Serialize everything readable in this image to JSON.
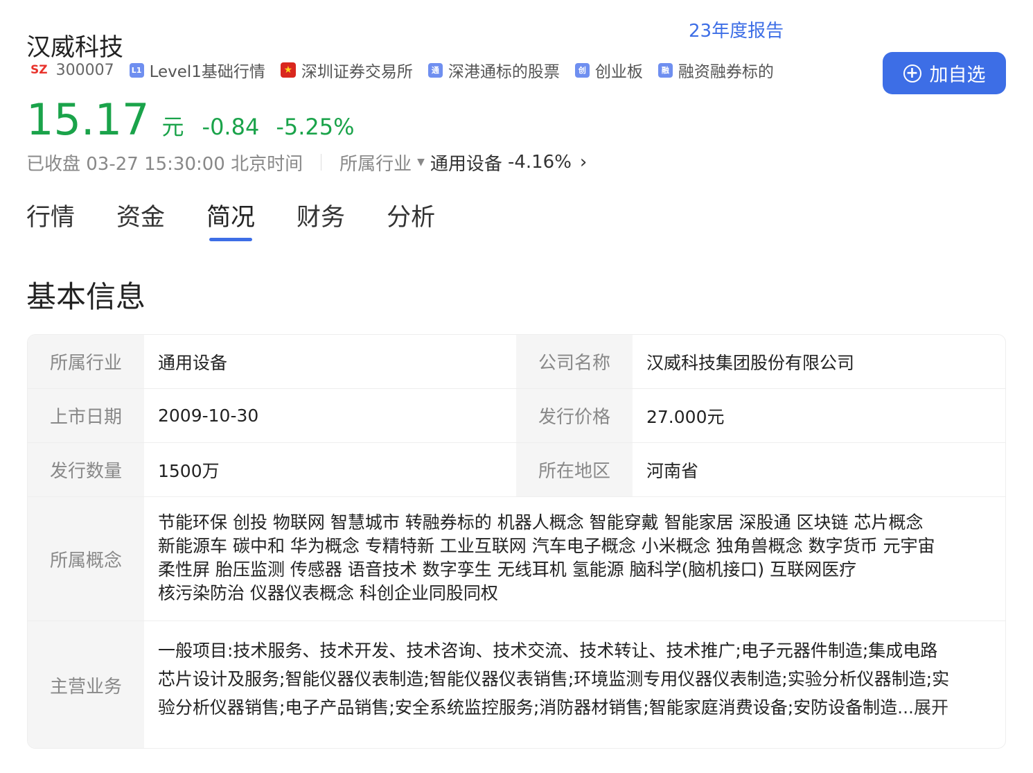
{
  "header": {
    "report_link": "23年度报告",
    "stock_name": "汉威科技",
    "market": "SZ",
    "code": "300007",
    "tags": [
      {
        "icon": "L1",
        "label": "Level1基础行情"
      },
      {
        "icon": "★",
        "label": "深圳证券交易所"
      },
      {
        "icon": "通",
        "label": "深港通标的股票"
      },
      {
        "icon": "创",
        "label": "创业板"
      },
      {
        "icon": "融",
        "label": "融资融券标的"
      }
    ],
    "add_button": "加自选"
  },
  "quote": {
    "price": "15.17",
    "unit": "元",
    "change": "-0.84",
    "change_pct": "-5.25%",
    "status": "已收盘 03-27 15:30:00 北京时间",
    "industry_label": "所属行业",
    "industry_name": "通用设备",
    "industry_pct": "-4.16%"
  },
  "tabs": [
    "行情",
    "资金",
    "简况",
    "财务",
    "分析"
  ],
  "section_title": "基本信息",
  "info": {
    "industry_label": "所属行业",
    "industry_value": "通用设备",
    "company_label": "公司名称",
    "company_value": "汉威科技集团股份有限公司",
    "listing_label": "上市日期",
    "listing_value": "2009-10-30",
    "price_label": "发行价格",
    "price_value": "27.000元",
    "shares_label": "发行数量",
    "shares_value": "1500万",
    "region_label": "所在地区",
    "region_value": "河南省",
    "concepts_label": "所属概念",
    "concepts_lines": [
      "节能环保 创投 物联网 智慧城市 转融券标的 机器人概念 智能穿戴 智能家居 深股通 区块链 芯片概念",
      "新能源车 碳中和 华为概念 专精特新 工业互联网 汽车电子概念 小米概念 独角兽概念 数字货币 元宇宙",
      "柔性屏 胎压监测 传感器 语音技术 数字孪生 无线耳机 氢能源 脑科学(脑机接口) 互联网医疗",
      "核污染防治 仪器仪表概念 科创企业同股同权"
    ],
    "business_label": "主营业务",
    "business_lines": [
      "一般项目:技术服务、技术开发、技术咨询、技术交流、技术转让、技术推广;电子元器件制造;集成电路",
      "芯片设计及服务;智能仪器仪表制造;智能仪器仪表销售;环境监测专用仪器仪表制造;实验分析仪器制造;实",
      "验分析仪器销售;电子产品销售;安全系统监控服务;消防器材销售;智能家庭消费设备;安防设备制造"
    ],
    "expand": "...展开"
  }
}
